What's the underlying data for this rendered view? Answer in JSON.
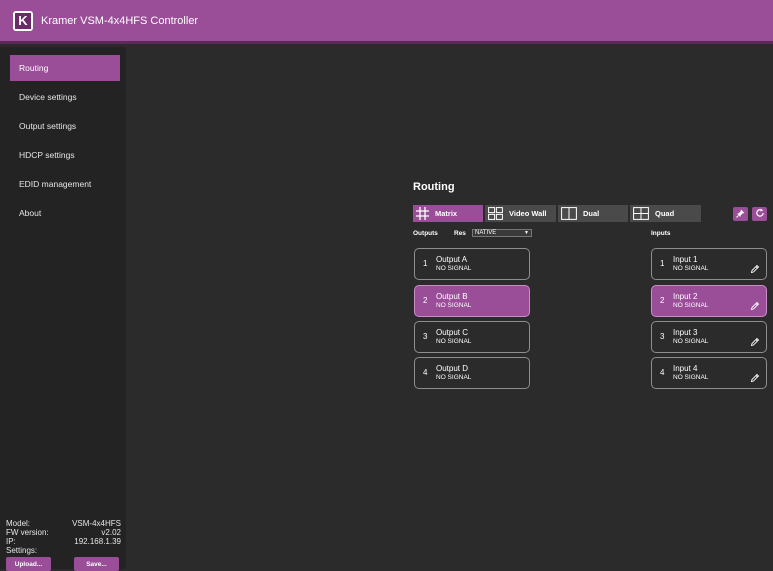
{
  "app": {
    "title": "Kramer VSM-4x4HFS Controller",
    "logo_letter": "K"
  },
  "sidebar": {
    "items": [
      {
        "label": "Routing",
        "active": true
      },
      {
        "label": "Device settings",
        "active": false
      },
      {
        "label": "Output settings",
        "active": false
      },
      {
        "label": "HDCP settings",
        "active": false
      },
      {
        "label": "EDID management",
        "active": false
      },
      {
        "label": "About",
        "active": false
      }
    ],
    "info": {
      "model_label": "Model:",
      "model_value": "VSM-4x4HFS",
      "fw_label": "FW version:",
      "fw_value": "v2.02",
      "ip_label": "IP:",
      "ip_value": "192.168.1.39",
      "settings_label": "Settings:"
    },
    "upload_label": "Upload...",
    "save_label": "Save..."
  },
  "main": {
    "title": "Routing",
    "tabs": [
      {
        "label": "Matrix",
        "icon": "grid-icon",
        "active": true
      },
      {
        "label": "Video Wall",
        "icon": "video-wall-icon",
        "active": false
      },
      {
        "label": "Dual",
        "icon": "dual-icon",
        "active": false
      },
      {
        "label": "Quad",
        "icon": "quad-icon",
        "active": false
      }
    ],
    "outputs_label": "Outputs",
    "res_label": "Res",
    "res_value": "NATIVE",
    "inputs_label": "Inputs",
    "outputs": [
      {
        "num": "1",
        "name": "Output A",
        "signal": "NO SIGNAL",
        "active": false
      },
      {
        "num": "2",
        "name": "Output B",
        "signal": "NO SIGNAL",
        "active": true
      },
      {
        "num": "3",
        "name": "Output C",
        "signal": "NO SIGNAL",
        "active": false
      },
      {
        "num": "4",
        "name": "Output D",
        "signal": "NO SIGNAL",
        "active": false
      }
    ],
    "inputs": [
      {
        "num": "1",
        "name": "Input 1",
        "signal": "NO SIGNAL",
        "active": false
      },
      {
        "num": "2",
        "name": "Input 2",
        "signal": "NO SIGNAL",
        "active": true
      },
      {
        "num": "3",
        "name": "Input 3",
        "signal": "NO SIGNAL",
        "active": false
      },
      {
        "num": "4",
        "name": "Input 4",
        "signal": "NO SIGNAL",
        "active": false
      }
    ]
  },
  "colors": {
    "accent": "#9a4e98",
    "background": "#2b2b2b",
    "sidebar": "#232323",
    "tab_inactive": "#4a4a4a"
  }
}
